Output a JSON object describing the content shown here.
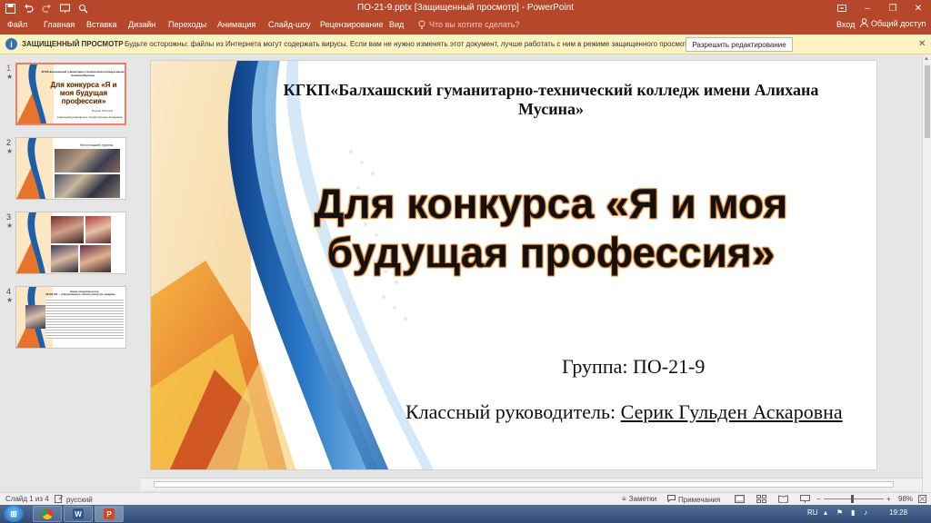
{
  "window": {
    "title": "ПО-21-9.pptx [Защищенный просмотр] - PowerPoint",
    "controls": [
      "–",
      "❐",
      "✕"
    ],
    "qat_icons": [
      "save-icon",
      "undo-icon",
      "redo-icon",
      "present-icon",
      "print-preview-icon"
    ]
  },
  "ribbon": {
    "tabs": [
      "Файл",
      "Главная",
      "Вставка",
      "Дизайн",
      "Переходы",
      "Анимация",
      "Слайд-шоу",
      "Рецензирование",
      "Вид"
    ],
    "tell_me": "Что вы хотите сделать?",
    "sign_in": "Вход",
    "share": "Общий доступ"
  },
  "protected_view": {
    "title": "ЗАЩИЩЕННЫЙ ПРОСМОТР",
    "message": "Будьте осторожны: файлы из Интернета могут содержать вирусы. Если вам не нужно изменять этот документ, лучше работать с ним в режиме защищенного просмотра.",
    "button": "Разрешить редактирование",
    "close": "✕"
  },
  "thumbnails": [
    {
      "num": "1",
      "star": "★",
      "title": "КГКП«Балхашский гуманитарно-технический колледж имени Алихана Мусина»",
      "main": "Для конкурса «Я и моя будущая профессия»",
      "line1": "Группа: ПО-21-9",
      "line2": "Классный руководитель: Серик Гульден Аскаровна"
    },
    {
      "num": "2",
      "star": "★",
      "caption": "Фото нашей группы"
    },
    {
      "num": "3",
      "star": "★"
    },
    {
      "num": "4",
      "star": "★",
      "heading": "Наша специальность",
      "subheading": "06120100 – «Программное обеспечение (по видам)»"
    }
  ],
  "slide": {
    "college": "КГКП«Балхашский гуманитарно-технический колледж имени Алихана Мусина»",
    "main_title": "Для конкурса «Я и моя будущая профессия»",
    "group": "Группа: ПО-21-9",
    "teacher_label": "Классный руководитель:",
    "teacher_name": "Серик Гульден Аскаровна"
  },
  "status_bar": {
    "slide_info": "Слайд 1 из 4",
    "language": "русский",
    "notes": "Заметки",
    "comments": "Примечания",
    "zoom": "98%"
  },
  "taskbar": {
    "lang": "RU",
    "time": "19:28"
  },
  "colors": {
    "ribbon": "#b7472a",
    "protected_bar": "#fcf3c0",
    "active_thumb_border": "#e8806a",
    "title_glow": "#f08a30"
  }
}
